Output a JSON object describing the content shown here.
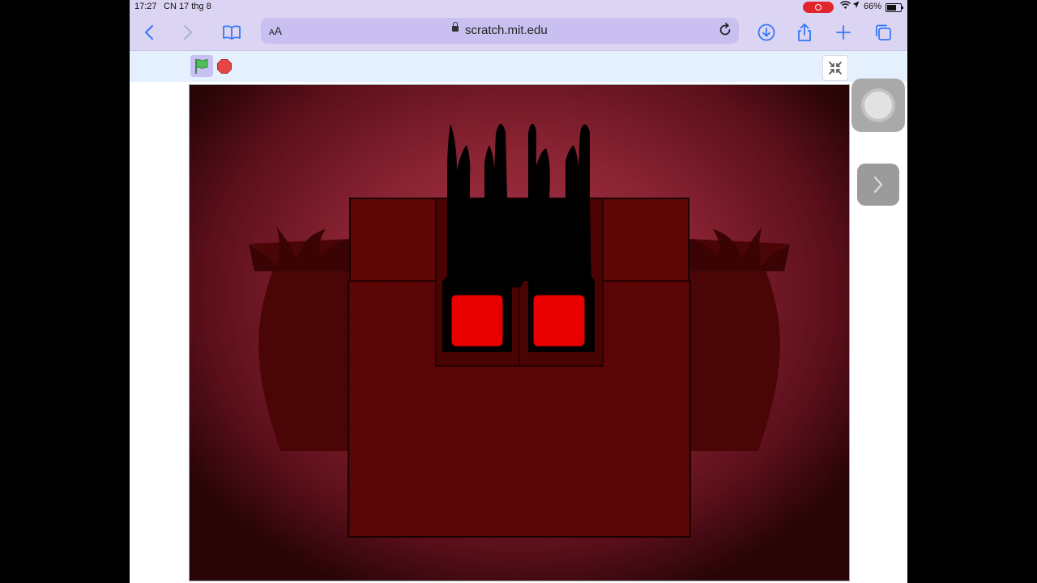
{
  "status_bar": {
    "time": "17:27",
    "date": "CN 17 thg 8",
    "battery": "66%"
  },
  "browser": {
    "text_size_label_small": "A",
    "text_size_label_large": "A",
    "url": "scratch.mit.edu",
    "icons": [
      "back-icon",
      "forward-icon",
      "bookmarks-icon",
      "lock-icon",
      "reload-icon",
      "download-icon",
      "share-icon",
      "new-tab-icon",
      "tabs-icon"
    ]
  },
  "scratch": {
    "icons": [
      "green-flag-icon",
      "stop-icon",
      "exit-fullscreen-icon"
    ]
  },
  "colors": {
    "toolbar_bg": "#dcd4f3",
    "accent": "#3478f6",
    "stage_bg": "#8a2333",
    "creature_body": "#5c0505",
    "eyes": "#e80000",
    "flag": "#4cbf56",
    "stop": "#e84545"
  }
}
